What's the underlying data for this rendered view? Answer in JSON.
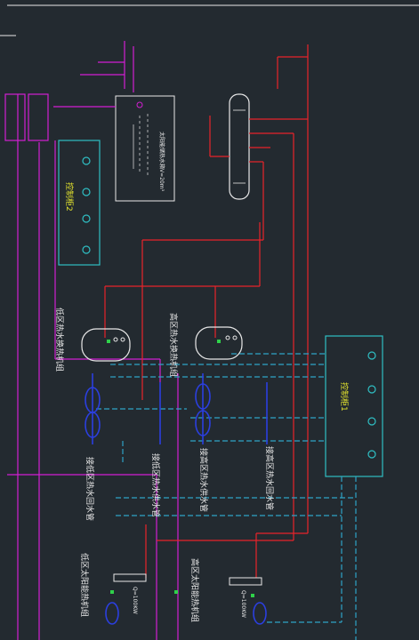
{
  "colors": {
    "background": "#232a30",
    "hot_supply": "#e8232b",
    "cold_return": "#2ea3c7",
    "magenta": "#d21fd2",
    "panel": "#2fbfc4",
    "equipment": "#e8e8e8",
    "pump": "#2b3fe0",
    "yellow": "#e6e62e",
    "green": "#2fd14a"
  },
  "labels": {
    "control_panel_1": "控制柜1",
    "control_panel_2": "控制柜2",
    "high_zone_exchanger": "高区热水换热机组",
    "low_zone_exchanger": "低区热水换热机组",
    "high_zone_supply_pipe": "接高区热水供水管",
    "high_zone_return_pipe": "接高区热水回水管",
    "low_zone_supply_pipe": "接低区热水供水管",
    "low_zone_return_pipe": "接低区热水回水管",
    "high_zone_solar_unit": "高区太阳能热机组",
    "low_zone_solar_unit": "低区太阳能热机组",
    "tank_label": "太阳能储热水箱V=20m³",
    "heater_left": "Q=100KW",
    "heater_right": "Q=100KW"
  }
}
